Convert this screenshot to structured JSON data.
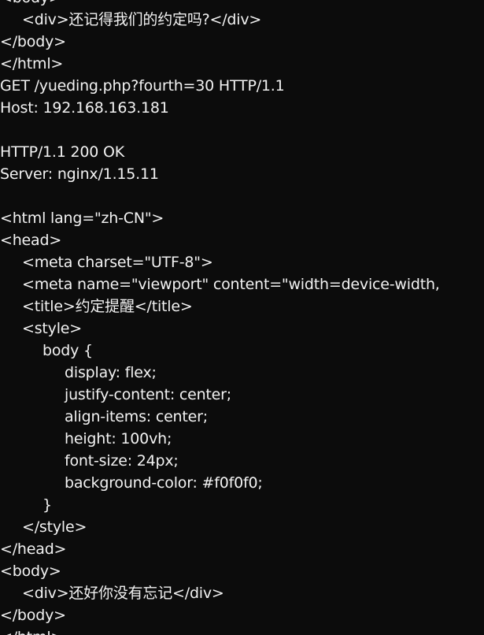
{
  "terminal": {
    "lines": [
      "<body>",
      "<div>还记得我们的约定吗?</div>",
      "</body>",
      "</html>",
      "GET /yueding.php?fourth=30 HTTP/1.1",
      "Host: 192.168.163.181",
      "",
      "HTTP/1.1 200 OK",
      "Server: nginx/1.15.11",
      "",
      "<html lang=\"zh-CN\">",
      "<head>",
      "<meta charset=\"UTF-8\">",
      "<meta name=\"viewport\" content=\"width=device-width,",
      "<title>约定提醒</title>",
      "<style>",
      "body {",
      "display: flex;",
      "justify-content: center;",
      "align-items: center;",
      "height: 100vh;",
      "font-size: 24px;",
      "background-color: #f0f0f0;",
      "}",
      "</style>",
      "</head>",
      "<body>",
      "<div>还好你没有忘记</div>",
      "</body>",
      "</html>"
    ]
  }
}
